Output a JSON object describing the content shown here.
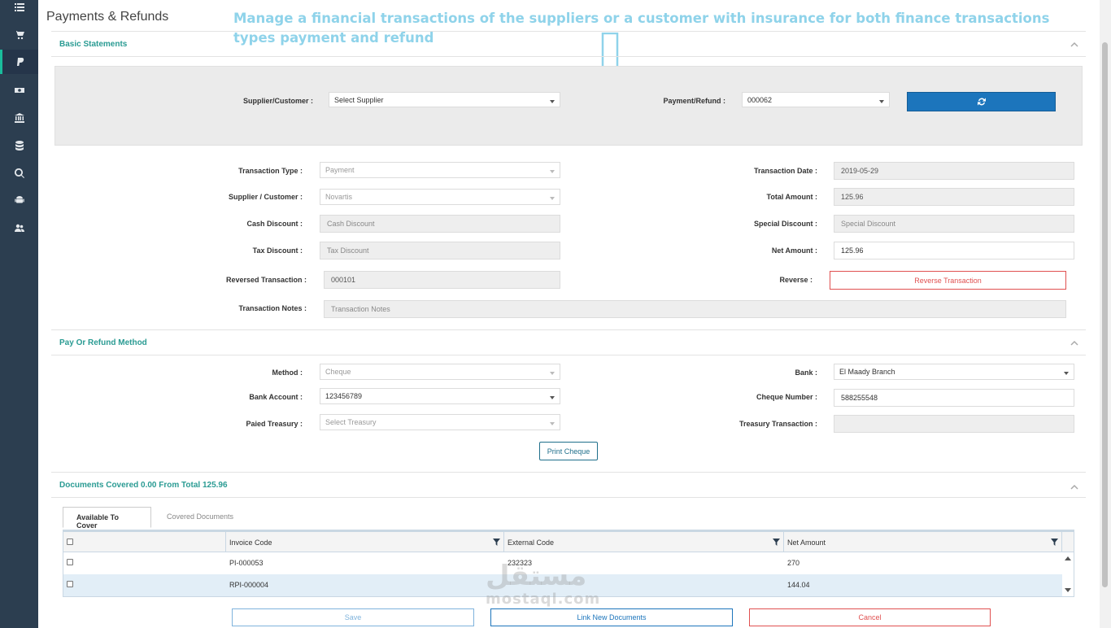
{
  "sidebar": {
    "items": [
      {
        "icon": "list-icon"
      },
      {
        "icon": "cart-icon"
      },
      {
        "icon": "paypal-icon",
        "active": true
      },
      {
        "icon": "money-icon"
      },
      {
        "icon": "bank-icon"
      },
      {
        "icon": "database-icon"
      },
      {
        "icon": "search-icon"
      },
      {
        "icon": "android-icon"
      },
      {
        "icon": "users-icon"
      }
    ]
  },
  "header": {
    "title": "Payments & Refunds",
    "annotation": "Manage a financial transactions of the suppliers or a customer with insurance for both finance transactions types payment and refund"
  },
  "basic_statements": {
    "title": "Basic Statements",
    "filters": {
      "supplier_label": "Supplier/Customer :",
      "supplier_value": "Select Supplier",
      "payment_label": "Payment/Refund :",
      "payment_value": "000062"
    },
    "fields": {
      "transaction_type_label": "Transaction Type :",
      "transaction_type_value": "Payment",
      "supplier_customer_label": "Supplier / Customer :",
      "supplier_customer_value": "Novartis",
      "cash_discount_label": "Cash Discount :",
      "cash_discount_placeholder": "Cash Discount",
      "tax_discount_label": "Tax Discount :",
      "tax_discount_placeholder": "Tax Discount",
      "reversed_transaction_label": "Reversed Transaction :",
      "reversed_transaction_value": "000101",
      "transaction_notes_label": "Transaction Notes :",
      "transaction_notes_placeholder": "Transaction Notes",
      "transaction_date_label": "Transaction Date :",
      "transaction_date_value": "2019-05-29",
      "total_amount_label": "Total Amount :",
      "total_amount_value": "125.96",
      "special_discount_label": "Special Discount :",
      "special_discount_placeholder": "Special Discount",
      "net_amount_label": "Net Amount :",
      "net_amount_value": "125.96",
      "reverse_label": "Reverse :",
      "reverse_button": "Reverse Transaction"
    }
  },
  "pay_method": {
    "title": "Pay Or Refund Method",
    "method_label": "Method :",
    "method_value": "Cheque",
    "bank_account_label": "Bank Account :",
    "bank_account_value": "123456789",
    "paied_treasury_label": "Paied Treasury :",
    "paied_treasury_value": "Select Treasury",
    "bank_label": "Bank :",
    "bank_value": "El Maady Branch",
    "cheque_number_label": "Cheque Number :",
    "cheque_number_value": "588255548",
    "treasury_transaction_label": "Treasury Transaction :",
    "print_button": "Print Cheque"
  },
  "documents": {
    "title": "Documents Covered 0.00 From Total 125.96",
    "tabs": [
      "Available To Cover",
      "Covered Documents"
    ],
    "columns": [
      "Invoice Code",
      "External Code",
      "Net Amount"
    ],
    "rows": [
      {
        "invoice": "PI-000053",
        "external": "232323",
        "net": "270"
      },
      {
        "invoice": "RPI-000004",
        "external": "",
        "net": "144.04"
      }
    ]
  },
  "actions": {
    "save": "Save",
    "link": "Link New Documents",
    "cancel": "Cancel"
  },
  "watermark": {
    "arabic": "مستقل",
    "latin": "mostaql.com"
  },
  "colors": {
    "sidebar": "#2c3e50",
    "accent_teal": "#2a9b93",
    "primary_blue": "#1c75bc",
    "danger": "#e05050",
    "annotation": "#8fd3ea"
  }
}
